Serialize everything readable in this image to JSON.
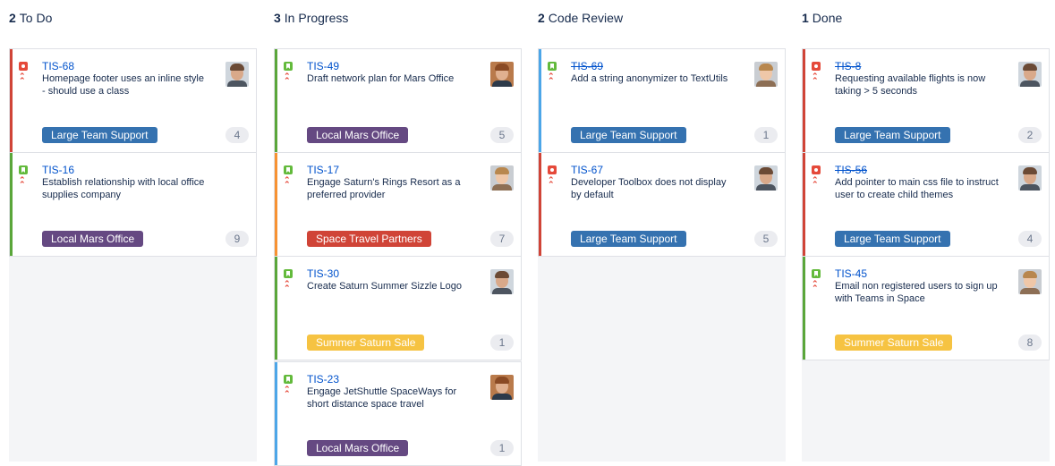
{
  "colors": {
    "bug": "#e5493a",
    "story": "#63ba3c",
    "priority": "#e5493a",
    "bar_red": "#d04437",
    "bar_green": "#5aa63a",
    "bar_orange": "#f79232",
    "bar_blue": "#4ca6e8",
    "epic_blue": "#3572b0",
    "epic_purple": "#654982",
    "epic_red": "#d04437",
    "epic_yellow": "#f6c342"
  },
  "columns": [
    {
      "count": "2",
      "title": "To Do",
      "cards": [
        {
          "key": "TIS-68",
          "summary": "Homepage footer uses an inline style - should use a class",
          "type": "bug-icon",
          "bar": "#d04437",
          "epic": "Large Team Support",
          "epic_color": "#3572b0",
          "estimate": "4",
          "avatar": "man-1",
          "done": false
        },
        {
          "key": "TIS-16",
          "summary": "Establish relationship with local office supplies company",
          "type": "story-icon",
          "bar": "#5aa63a",
          "epic": "Local Mars Office",
          "epic_color": "#654982",
          "estimate": "9",
          "avatar": "",
          "done": false
        }
      ]
    },
    {
      "count": "3",
      "title": "In Progress",
      "cards": [
        {
          "key": "TIS-49",
          "summary": "Draft network plan for Mars Office",
          "type": "story-icon",
          "bar": "#5aa63a",
          "epic": "Local Mars Office",
          "epic_color": "#654982",
          "estimate": "5",
          "avatar": "man-2",
          "done": false
        },
        {
          "key": "TIS-17",
          "summary": "Engage Saturn's Rings Resort as a preferred provider",
          "type": "story-icon",
          "bar": "#f79232",
          "epic": "Space Travel Partners",
          "epic_color": "#d04437",
          "estimate": "7",
          "avatar": "woman-1",
          "done": false
        },
        {
          "key": "TIS-30",
          "summary": "Create Saturn Summer Sizzle Logo",
          "type": "story-icon",
          "bar": "#5aa63a",
          "epic": "Summer Saturn Sale",
          "epic_color": "#f6c342",
          "estimate": "1",
          "avatar": "man-1",
          "done": false
        },
        {
          "key": "TIS-23",
          "summary": "Engage JetShuttle SpaceWays for short distance space travel",
          "type": "story-icon",
          "bar": "#4ca6e8",
          "epic": "Local Mars Office",
          "epic_color": "#654982",
          "estimate": "1",
          "avatar": "man-2",
          "done": false
        }
      ]
    },
    {
      "count": "2",
      "title": "Code Review",
      "cards": [
        {
          "key": "TIS-69",
          "summary": "Add a string anonymizer to TextUtils",
          "type": "story-icon",
          "bar": "#4ca6e8",
          "epic": "Large Team Support",
          "epic_color": "#3572b0",
          "estimate": "1",
          "avatar": "woman-1",
          "done": true
        },
        {
          "key": "TIS-67",
          "summary": "Developer Toolbox does not display by default",
          "type": "bug-icon",
          "bar": "#d04437",
          "epic": "Large Team Support",
          "epic_color": "#3572b0",
          "estimate": "5",
          "avatar": "man-1",
          "done": false
        }
      ]
    },
    {
      "count": "1",
      "title": "Done",
      "cards": [
        {
          "key": "TIS-8",
          "summary": "Requesting available flights is now taking > 5 seconds",
          "type": "bug-icon",
          "bar": "#d04437",
          "epic": "Large Team Support",
          "epic_color": "#3572b0",
          "estimate": "2",
          "avatar": "man-1",
          "done": true
        },
        {
          "key": "TIS-56",
          "summary": "Add pointer to main css file to instruct user to create child themes",
          "type": "bug-icon",
          "bar": "#d04437",
          "epic": "Large Team Support",
          "epic_color": "#3572b0",
          "estimate": "4",
          "avatar": "man-1",
          "done": true
        },
        {
          "key": "TIS-45",
          "summary": "Email non registered users to sign up with Teams in Space",
          "type": "story-icon",
          "bar": "#5aa63a",
          "epic": "Summer Saturn Sale",
          "epic_color": "#f6c342",
          "estimate": "8",
          "avatar": "woman-1",
          "done": false
        }
      ]
    }
  ]
}
